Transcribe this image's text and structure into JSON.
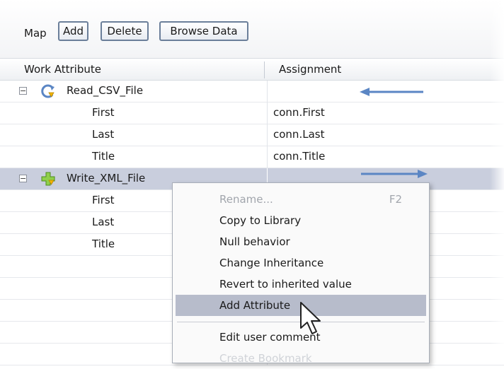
{
  "toolbar": {
    "label": "Map",
    "add_label": "Add",
    "delete_label": "Delete",
    "browse_label": "Browse Data"
  },
  "grid": {
    "headers": {
      "work_attribute": "Work Attribute",
      "assignment": "Assignment"
    },
    "rows": [
      {
        "kind": "group",
        "name": "Read_CSV_File",
        "assignment": "",
        "expander": "−",
        "icon": "read-file-icon",
        "arrow": "left"
      },
      {
        "kind": "child",
        "name": "First",
        "assignment": "conn.First"
      },
      {
        "kind": "child",
        "name": "Last",
        "assignment": "conn.Last"
      },
      {
        "kind": "child",
        "name": "Title",
        "assignment": "conn.Title"
      },
      {
        "kind": "group",
        "name": "Write_XML_File",
        "assignment": "",
        "expander": "−",
        "icon": "write-file-icon",
        "arrow": "right",
        "selected": true
      },
      {
        "kind": "child",
        "name": "First",
        "assignment": ""
      },
      {
        "kind": "child",
        "name": "Last",
        "assignment": ""
      },
      {
        "kind": "child",
        "name": "Title",
        "assignment": ""
      }
    ]
  },
  "context_menu": {
    "items": [
      {
        "label": "Rename...",
        "shortcut": "F2",
        "disabled": true
      },
      {
        "label": "Copy to Library"
      },
      {
        "label": "Null behavior"
      },
      {
        "label": "Change Inheritance"
      },
      {
        "label": "Revert to inherited value"
      },
      {
        "label": "Add Attribute",
        "highlighted": true
      },
      {
        "label": "Edit user comment"
      },
      {
        "label": "Create Bookmark",
        "disabled": true
      }
    ]
  },
  "colors": {
    "selection": "#c9cedd",
    "menu_highlight": "#b7bccb",
    "arrow": "#5b86c4",
    "button_border": "#6b7f9a"
  }
}
